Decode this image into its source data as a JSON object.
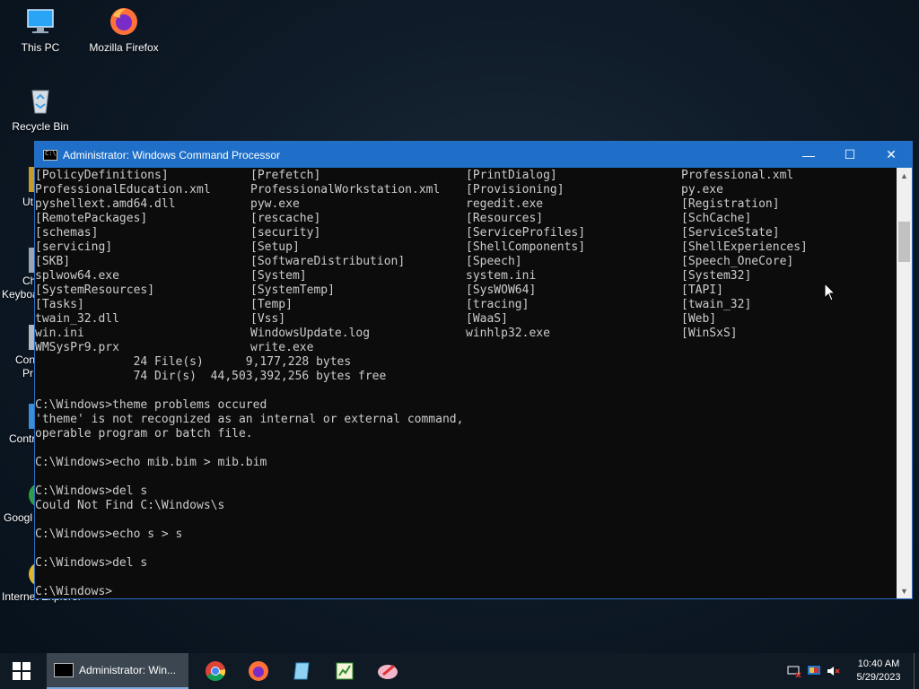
{
  "desktop": {
    "icons": [
      {
        "label": "This PC",
        "icon": "this-pc-icon"
      },
      {
        "label": "Mozilla Firefox",
        "icon": "firefox-icon"
      },
      {
        "label": "Recycle Bin",
        "icon": "recycle-bin-icon"
      }
    ],
    "partial_labels": [
      "Ut",
      "Ch",
      "Keyboa",
      "Con",
      "Pr",
      "Contr",
      "Googl",
      "Internet Explorer"
    ]
  },
  "window": {
    "title": "Administrator: Windows Command Processor",
    "buttons": {
      "minimize": "—",
      "maximize": "☐",
      "close": "✕"
    }
  },
  "terminal": {
    "dir_rows": [
      [
        "[PolicyDefinitions]",
        "[Prefetch]",
        "[PrintDialog]",
        "Professional.xml"
      ],
      [
        "ProfessionalEducation.xml",
        "ProfessionalWorkstation.xml",
        "[Provisioning]",
        "py.exe"
      ],
      [
        "pyshellext.amd64.dll",
        "pyw.exe",
        "regedit.exe",
        "[Registration]"
      ],
      [
        "[RemotePackages]",
        "[rescache]",
        "[Resources]",
        "[SchCache]"
      ],
      [
        "[schemas]",
        "[security]",
        "[ServiceProfiles]",
        "[ServiceState]"
      ],
      [
        "[servicing]",
        "[Setup]",
        "[ShellComponents]",
        "[ShellExperiences]"
      ],
      [
        "[SKB]",
        "[SoftwareDistribution]",
        "[Speech]",
        "[Speech_OneCore]"
      ],
      [
        "splwow64.exe",
        "[System]",
        "system.ini",
        "[System32]"
      ],
      [
        "[SystemResources]",
        "[SystemTemp]",
        "[SysWOW64]",
        "[TAPI]"
      ],
      [
        "[Tasks]",
        "[Temp]",
        "[tracing]",
        "[twain_32]"
      ],
      [
        "twain_32.dll",
        "[Vss]",
        "[WaaS]",
        "[Web]"
      ],
      [
        "win.ini",
        "WindowsUpdate.log",
        "winhlp32.exe",
        "[WinSxS]"
      ],
      [
        "WMSysPr9.prx",
        "write.exe",
        "",
        ""
      ]
    ],
    "summary": [
      "              24 File(s)      9,177,228 bytes",
      "              74 Dir(s)  44,503,392,256 bytes free"
    ],
    "session": [
      "",
      "C:\\Windows>theme problems occured",
      "'theme' is not recognized as an internal or external command,",
      "operable program or batch file.",
      "",
      "C:\\Windows>echo mib.bim > mib.bim",
      "",
      "C:\\Windows>del s",
      "Could Not Find C:\\Windows\\s",
      "",
      "C:\\Windows>echo s > s",
      "",
      "C:\\Windows>del s",
      "",
      "C:\\Windows>"
    ]
  },
  "taskbar": {
    "active_app_label": "Administrator: Win...",
    "pinned": [
      "chrome-icon",
      "firefox-icon",
      "notepad-icon",
      "spreadsheet-icon",
      "paint-icon"
    ],
    "clock": {
      "time": "10:40 AM",
      "date": "5/29/2023"
    }
  },
  "colors": {
    "titlebar": "#1f6fc8",
    "terminal_bg": "#0c0c0c",
    "terminal_fg": "#cccccc",
    "taskbar": "#101a24"
  }
}
